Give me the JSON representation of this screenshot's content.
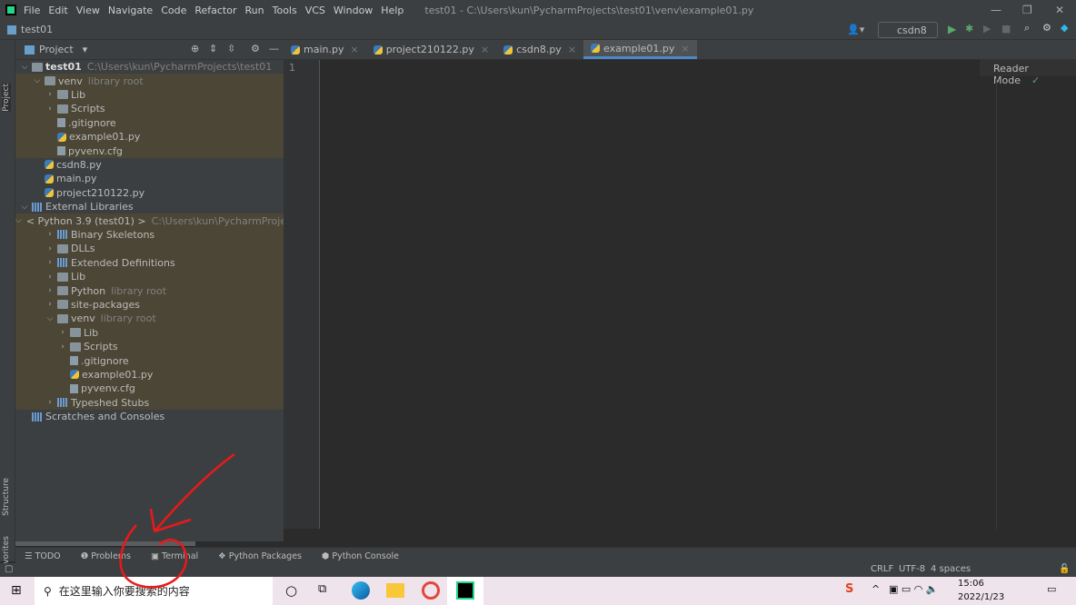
{
  "menu": {
    "items": [
      "File",
      "Edit",
      "View",
      "Navigate",
      "Code",
      "Refactor",
      "Run",
      "Tools",
      "VCS",
      "Window",
      "Help"
    ],
    "title": "test01 - C:\\Users\\kun\\PycharmProjects\\test01\\venv\\example01.py"
  },
  "navbar": {
    "project": "test01",
    "run_config": "csdn8"
  },
  "left_tool": {
    "project": "Project",
    "structure": "Structure",
    "favorites": "Favorites"
  },
  "project_panel": {
    "title": "Project"
  },
  "tree": [
    {
      "label": "test01",
      "hint": "C:\\Users\\kun\\PycharmProjects\\test01",
      "lvl": 0,
      "chev": "v",
      "icon": "folder",
      "bold": true
    },
    {
      "label": "venv",
      "hint": "library root",
      "lvl": 1,
      "chev": "v",
      "icon": "folder",
      "hl": true
    },
    {
      "label": "Lib",
      "lvl": 2,
      "chev": ">",
      "icon": "folder",
      "hl": true
    },
    {
      "label": "Scripts",
      "lvl": 2,
      "chev": ">",
      "icon": "folder",
      "hl": true
    },
    {
      "label": ".gitignore",
      "lvl": 2,
      "icon": "file",
      "hl": true
    },
    {
      "label": "example01.py",
      "lvl": 2,
      "icon": "py",
      "hl": true
    },
    {
      "label": "pyvenv.cfg",
      "lvl": 2,
      "icon": "file",
      "hl": true
    },
    {
      "label": "csdn8.py",
      "lvl": 1,
      "icon": "py"
    },
    {
      "label": "main.py",
      "lvl": 1,
      "icon": "py"
    },
    {
      "label": "project210122.py",
      "lvl": 1,
      "icon": "py"
    },
    {
      "label": "External Libraries",
      "lvl": 0,
      "chev": "v",
      "icon": "lib"
    },
    {
      "label": "< Python 3.9 (test01) >",
      "hint": "C:\\Users\\kun\\PycharmProjects\\t",
      "lvl": 1,
      "chev": "v",
      "icon": "py",
      "hl": true
    },
    {
      "label": "Binary Skeletons",
      "lvl": 2,
      "chev": ">",
      "icon": "lib",
      "hl": true
    },
    {
      "label": "DLLs",
      "lvl": 2,
      "chev": ">",
      "icon": "folder",
      "hl": true
    },
    {
      "label": "Extended Definitions",
      "lvl": 2,
      "chev": ">",
      "icon": "lib",
      "hl": true
    },
    {
      "label": "Lib",
      "lvl": 2,
      "chev": ">",
      "icon": "folder",
      "hl": true
    },
    {
      "label": "Python",
      "hint": "library root",
      "lvl": 2,
      "chev": ">",
      "icon": "folder",
      "hl": true
    },
    {
      "label": "site-packages",
      "lvl": 2,
      "chev": ">",
      "icon": "folder",
      "hl": true
    },
    {
      "label": "venv",
      "hint": "library root",
      "lvl": 2,
      "chev": "v",
      "icon": "folder",
      "hl": true
    },
    {
      "label": "Lib",
      "lvl": 3,
      "chev": ">",
      "icon": "folder",
      "hl": true
    },
    {
      "label": "Scripts",
      "lvl": 3,
      "chev": ">",
      "icon": "folder",
      "hl": true
    },
    {
      "label": ".gitignore",
      "lvl": 3,
      "icon": "file",
      "hl": true
    },
    {
      "label": "example01.py",
      "lvl": 3,
      "icon": "py",
      "hl": true
    },
    {
      "label": "pyvenv.cfg",
      "lvl": 3,
      "icon": "file",
      "hl": true
    },
    {
      "label": "Typeshed Stubs",
      "lvl": 2,
      "chev": ">",
      "icon": "lib",
      "hl": true
    },
    {
      "label": "Scratches and Consoles",
      "lvl": 0,
      "icon": "lib"
    }
  ],
  "tabs": [
    {
      "label": "main.py"
    },
    {
      "label": "project210122.py"
    },
    {
      "label": "csdn8.py"
    },
    {
      "label": "example01.py",
      "active": true
    }
  ],
  "editor": {
    "line_number": "1",
    "reader_mode": "Reader Mode"
  },
  "bottom_tabs": [
    "TODO",
    "Problems",
    "Terminal",
    "Python Packages",
    "Python Console"
  ],
  "status": {
    "line_sep": "CRLF",
    "encoding": "UTF-8",
    "indent": "4 spaces"
  },
  "taskbar": {
    "search_placeholder": "在这里输入你要搜索的内容",
    "time": "15:06",
    "date": "2022/1/23"
  },
  "annotation_color": "#e8191b"
}
